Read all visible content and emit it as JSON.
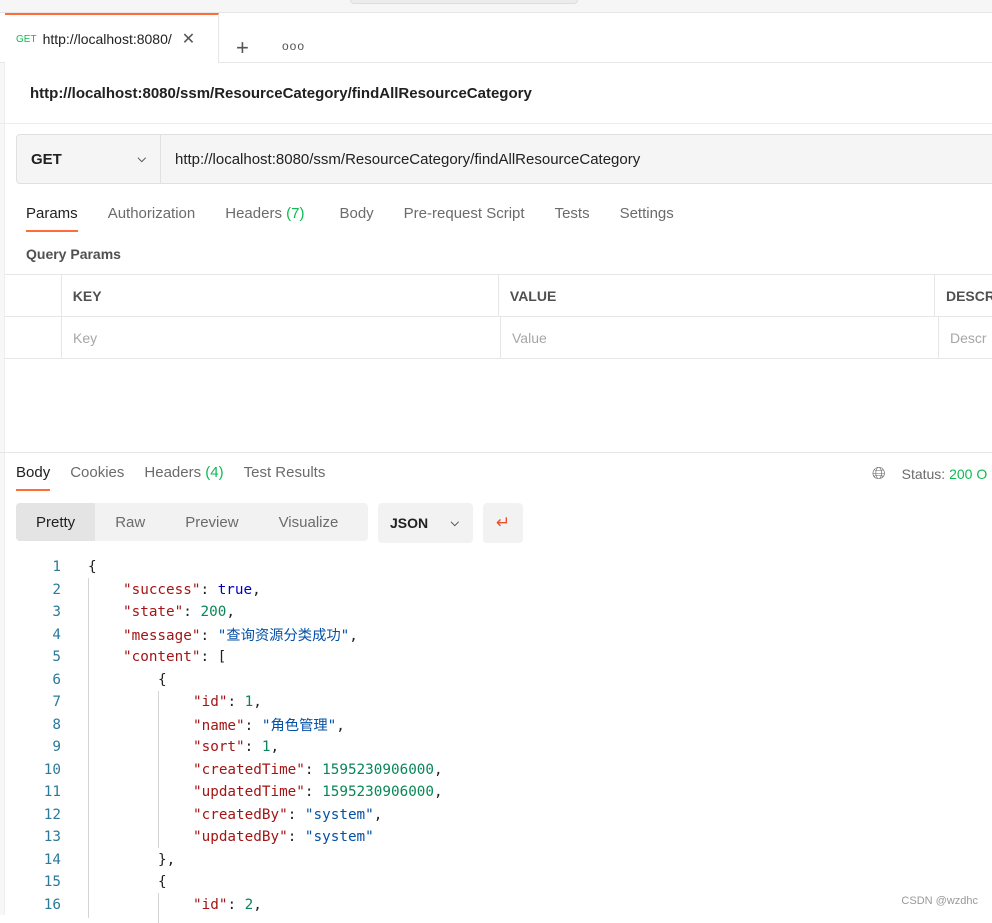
{
  "tab": {
    "method": "GET",
    "label": "http://localhost:8080/",
    "close": "✕",
    "new": "+",
    "more": "ooo"
  },
  "request": {
    "title": "http://localhost:8080/ssm/ResourceCategory/findAllResourceCategory",
    "method": "GET",
    "url": "http://localhost:8080/ssm/ResourceCategory/findAllResourceCategory"
  },
  "req_tabs": [
    {
      "label": "Params"
    },
    {
      "label": "Authorization"
    },
    {
      "label": "Headers",
      "count": "(7)"
    },
    {
      "label": "Body"
    },
    {
      "label": "Pre-request Script"
    },
    {
      "label": "Tests"
    },
    {
      "label": "Settings"
    }
  ],
  "query_params": {
    "title": "Query Params",
    "headers": [
      "KEY",
      "VALUE",
      "DESCR"
    ],
    "placeholders": [
      "Key",
      "Value",
      "Descr"
    ]
  },
  "resp_tabs": [
    {
      "label": "Body"
    },
    {
      "label": "Cookies"
    },
    {
      "label": "Headers",
      "count": "(4)"
    },
    {
      "label": "Test Results"
    }
  ],
  "status": {
    "label": "Status:",
    "value": "200 O"
  },
  "view_modes": [
    "Pretty",
    "Raw",
    "Preview",
    "Visualize"
  ],
  "format": "JSON",
  "colors": {
    "accent": "#ff6c37",
    "key": "#a31515",
    "string": "#0451a5",
    "number": "#098658",
    "success": "#0cbb52"
  },
  "code": [
    {
      "i": 0,
      "t": [
        [
          "p",
          "{"
        ]
      ]
    },
    {
      "i": 1,
      "t": [
        [
          "k",
          "\"success\""
        ],
        [
          "p",
          ": "
        ],
        [
          "b",
          "true"
        ],
        [
          "p",
          ","
        ]
      ]
    },
    {
      "i": 1,
      "t": [
        [
          "k",
          "\"state\""
        ],
        [
          "p",
          ": "
        ],
        [
          "n",
          "200"
        ],
        [
          "p",
          ","
        ]
      ]
    },
    {
      "i": 1,
      "t": [
        [
          "k",
          "\"message\""
        ],
        [
          "p",
          ": "
        ],
        [
          "s",
          "\"查询资源分类成功\""
        ],
        [
          "p",
          ","
        ]
      ]
    },
    {
      "i": 1,
      "t": [
        [
          "k",
          "\"content\""
        ],
        [
          "p",
          ": ["
        ]
      ]
    },
    {
      "i": 2,
      "t": [
        [
          "p",
          "{"
        ]
      ]
    },
    {
      "i": 3,
      "t": [
        [
          "k",
          "\"id\""
        ],
        [
          "p",
          ": "
        ],
        [
          "n",
          "1"
        ],
        [
          "p",
          ","
        ]
      ]
    },
    {
      "i": 3,
      "t": [
        [
          "k",
          "\"name\""
        ],
        [
          "p",
          ": "
        ],
        [
          "s",
          "\"角色管理\""
        ],
        [
          "p",
          ","
        ]
      ]
    },
    {
      "i": 3,
      "t": [
        [
          "k",
          "\"sort\""
        ],
        [
          "p",
          ": "
        ],
        [
          "n",
          "1"
        ],
        [
          "p",
          ","
        ]
      ]
    },
    {
      "i": 3,
      "t": [
        [
          "k",
          "\"createdTime\""
        ],
        [
          "p",
          ": "
        ],
        [
          "n",
          "1595230906000"
        ],
        [
          "p",
          ","
        ]
      ]
    },
    {
      "i": 3,
      "t": [
        [
          "k",
          "\"updatedTime\""
        ],
        [
          "p",
          ": "
        ],
        [
          "n",
          "1595230906000"
        ],
        [
          "p",
          ","
        ]
      ]
    },
    {
      "i": 3,
      "t": [
        [
          "k",
          "\"createdBy\""
        ],
        [
          "p",
          ": "
        ],
        [
          "s",
          "\"system\""
        ],
        [
          "p",
          ","
        ]
      ]
    },
    {
      "i": 3,
      "t": [
        [
          "k",
          "\"updatedBy\""
        ],
        [
          "p",
          ": "
        ],
        [
          "s",
          "\"system\""
        ]
      ]
    },
    {
      "i": 2,
      "t": [
        [
          "p",
          "},"
        ]
      ]
    },
    {
      "i": 2,
      "t": [
        [
          "p",
          "{"
        ]
      ]
    },
    {
      "i": 3,
      "t": [
        [
          "k",
          "\"id\""
        ],
        [
          "p",
          ": "
        ],
        [
          "n",
          "2"
        ],
        [
          "p",
          ","
        ]
      ]
    }
  ],
  "watermark": "CSDN @wzdhc"
}
